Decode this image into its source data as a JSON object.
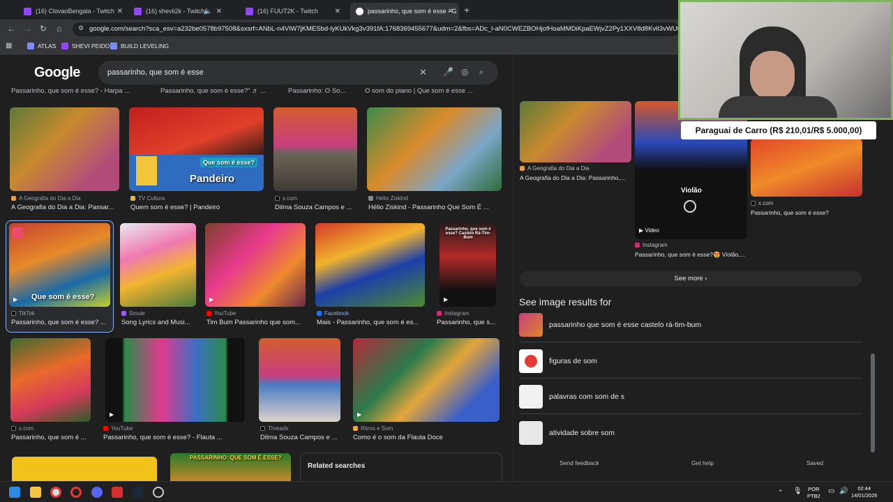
{
  "browser": {
    "tabs": [
      {
        "title": "(16) ClovaoBengala - Twitch"
      },
      {
        "title": "(16) shevii2k - Twitch"
      },
      {
        "title": "(16) FUUT2K - Twitch"
      },
      {
        "title": "passarinho, que som é esse - G"
      }
    ],
    "url": "google.com/search?sca_esv=a232be0578b97508&sxsrf=ANbL-n4VlW7jKMESbd-lyKUkVkg3v391fA:1768369455677&udm=2&fbs=ADc_l-aN0CWEZBOHjofHoaMMDiKpaEWjvZ2Py1XXV8d8KvlI3vWUtYx0DZ",
    "bookmarks": [
      "ATLAS",
      "SHEVI PEIDO",
      "BUILD LEVELING"
    ]
  },
  "search": {
    "logo": "Google",
    "query": "passarinho, que som é esse"
  },
  "top_captions": [
    "Passarinho, que som é esse? - Harpa ...",
    "Passarinho, que som é esse?\" ♬ ...",
    "Passarinho: O So...",
    "O som do piano | Que som é esse ..."
  ],
  "results": [
    {
      "source": "A Geografia do Dia a Dia",
      "caption": "A Geografia do Dia a Dia: Passar..."
    },
    {
      "source": "TV Cultura",
      "caption": "Quem som é esse? | Pandeiro",
      "overlay": "Que som é esse?",
      "overlay2": "Pandeiro"
    },
    {
      "source": "x.com",
      "caption": "Dilma Souza Campos e ..."
    },
    {
      "source": "Hélio Ziskind",
      "caption": "Hélio Ziskind - Passarinho Que Som É ..."
    },
    {
      "source": "TikTok",
      "caption": "Passarinho, que som é esse? ...",
      "overlay": "Que som é esse?"
    },
    {
      "source": "Smule",
      "caption": "Song Lyrics and Musi..."
    },
    {
      "source": "YouTube",
      "caption": "Tim Bum Passarinho que som..."
    },
    {
      "source": "Facebook",
      "caption": "Mais - Passarinho, que som é es..."
    },
    {
      "source": "Instagram",
      "caption": "Passarinho, que s...",
      "overlay": "Passarinho, que som é esse? Castelo Rá-Tim-Bum"
    },
    {
      "source": "x.com",
      "caption": "Passarinho, que som é ..."
    },
    {
      "source": "YouTube",
      "caption": "Passarinho, que som é esse? - Flauta ..."
    },
    {
      "source": "Threads",
      "caption": "Dilma Souza Campos e ..."
    },
    {
      "source": "Ritmo e Som",
      "caption": "Como é o som da Flauta Doce"
    }
  ],
  "bottom": {
    "related_searches": "Related searches",
    "thumb_overlay": "PASSARINHO: QUE SOM É ESSE?"
  },
  "right_panel": {
    "items": [
      {
        "source": "A Geografia do Dia a Dia",
        "caption": "A Geografia do Dia a Dia: Passarinho,..."
      },
      {
        "source": "Instagram",
        "caption": "Passarinho, que som é esse?😍 Violão,...",
        "badge": "Video",
        "overlay": "Violão"
      },
      {
        "source": "x.com",
        "caption": "Passarinho, que som é esse?"
      }
    ],
    "see_more": "See more",
    "see_image_results_for": "See image results for",
    "related": [
      "passarinho que som é esse castelo rá-tim-bum",
      "figuras de som",
      "palavras com som de s",
      "atividade sobre som"
    ],
    "footer": [
      "Send feedback",
      "Get help",
      "Saved"
    ]
  },
  "stream_banner": "Paraguai de Carro (R$ 210,01/R$ 5.000,00)",
  "taskbar": {
    "lang": "POR",
    "layout": "PTB2",
    "time": "02:44",
    "date": "14/01/2026"
  }
}
